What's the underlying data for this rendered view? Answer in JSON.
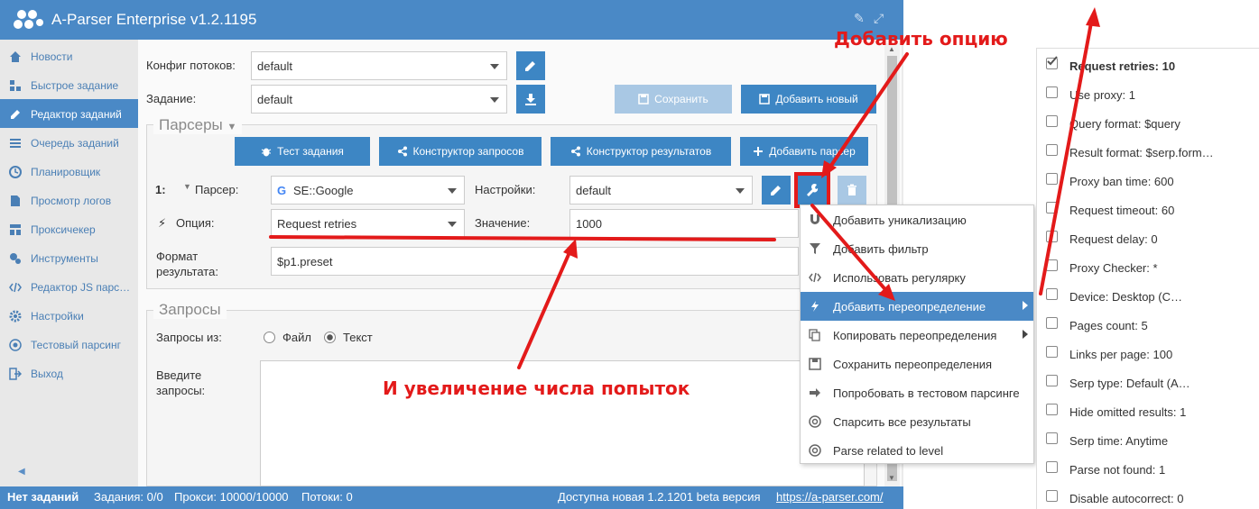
{
  "app": {
    "title": "A-Parser Enterprise v1.2.1195"
  },
  "sidebar": {
    "items": [
      {
        "label": "Новости",
        "icon": "home-icon"
      },
      {
        "label": "Быстрое задание",
        "icon": "quick-task-icon"
      },
      {
        "label": "Редактор заданий",
        "icon": "edit-icon",
        "active": true
      },
      {
        "label": "Очередь заданий",
        "icon": "list-icon"
      },
      {
        "label": "Планировщик",
        "icon": "clock-icon"
      },
      {
        "label": "Просмотр логов",
        "icon": "file-icon"
      },
      {
        "label": "Проксичекер",
        "icon": "proxy-icon"
      },
      {
        "label": "Инструменты",
        "icon": "tools-icon"
      },
      {
        "label": "Редактор JS парс…",
        "icon": "code-icon"
      },
      {
        "label": "Настройки",
        "icon": "gear-icon"
      },
      {
        "label": "Тестовый парсинг",
        "icon": "target-icon"
      },
      {
        "label": "Выход",
        "icon": "exit-icon"
      }
    ]
  },
  "form": {
    "threads_label": "Конфиг потоков:",
    "threads_value": "default",
    "task_label": "Задание:",
    "task_value": "default",
    "save_label": "Сохранить",
    "add_new_label": "Добавить новый"
  },
  "parsers": {
    "legend": "Парсеры",
    "buttons": {
      "test": "Тест задания",
      "query_builder": "Конструктор запросов",
      "result_builder": "Конструктор результатов",
      "add_parser": "Добавить парсер"
    },
    "row_number": "1:",
    "parser_label": "Парсер:",
    "parser_value": "SE::Google",
    "settings_label": "Настройки:",
    "settings_value": "default",
    "option_label": "Опция:",
    "option_value": "Request retries",
    "value_label": "Значение:",
    "value_value": "1000",
    "format_label_1": "Формат",
    "format_label_2": "результата:",
    "format_value": "$p1.preset"
  },
  "queries": {
    "legend": "Запросы",
    "from_label": "Запросы из:",
    "file_label": "Файл",
    "text_label": "Текст",
    "enter_label_1": "Введите",
    "enter_label_2": "запросы:"
  },
  "context_menu": {
    "items": [
      {
        "label": "Добавить уникализацию",
        "icon": "magnet-icon"
      },
      {
        "label": "Добавить фильтр",
        "icon": "filter-icon"
      },
      {
        "label": "Использовать регулярку",
        "icon": "code-icon"
      },
      {
        "label": "Добавить переопределение",
        "icon": "bolt-icon",
        "active": true,
        "submenu": true
      },
      {
        "label": "Копировать переопределения",
        "icon": "copy-icon",
        "submenu": true
      },
      {
        "label": "Сохранить переопределения",
        "icon": "save-icon"
      },
      {
        "label": "Попробовать в тестовом парсинге",
        "icon": "arrow-right-icon"
      },
      {
        "label": "Спарсить все результаты",
        "icon": "lifebuoy-icon"
      },
      {
        "label": "Parse related to level",
        "icon": "lifebuoy-icon"
      }
    ]
  },
  "status": {
    "no_tasks": "Нет заданий",
    "tasks": "Задания: 0/0",
    "proxies": "Прокси: 10000/10000",
    "threads": "Потоки: 0",
    "update": "Доступна новая 1.2.1201 beta версия",
    "link": "https://a-parser.com/"
  },
  "option_list": {
    "items": [
      {
        "label": "Request retries: 10",
        "checked": true
      },
      {
        "label": "Use proxy: 1",
        "checked": false
      },
      {
        "label": "Query format: $query",
        "checked": false
      },
      {
        "label": "Result format: $serp.form…",
        "checked": false
      },
      {
        "label": "Proxy ban time: 600",
        "checked": false
      },
      {
        "label": "Request timeout: 60",
        "checked": false
      },
      {
        "label": "Request delay: 0",
        "checked": false
      },
      {
        "label": "Proxy Checker: *",
        "checked": false
      },
      {
        "label": "Device: Desktop (C…",
        "checked": false
      },
      {
        "label": "Pages count: 5",
        "checked": false
      },
      {
        "label": "Links per page: 100",
        "checked": false
      },
      {
        "label": "Serp type: Default (A…",
        "checked": false
      },
      {
        "label": "Hide omitted results: 1",
        "checked": false
      },
      {
        "label": "Serp time: Anytime",
        "checked": false
      },
      {
        "label": "Parse not found: 1",
        "checked": false
      },
      {
        "label": "Disable autocorrect: 0",
        "checked": false
      }
    ]
  },
  "annotations": {
    "add_option": "Добавить опцию",
    "increase_retries": "И увеличение числа попыток"
  },
  "colors": {
    "primary": "#4a89c6",
    "button": "#3d86c4",
    "annotation": "#e31a1a"
  }
}
